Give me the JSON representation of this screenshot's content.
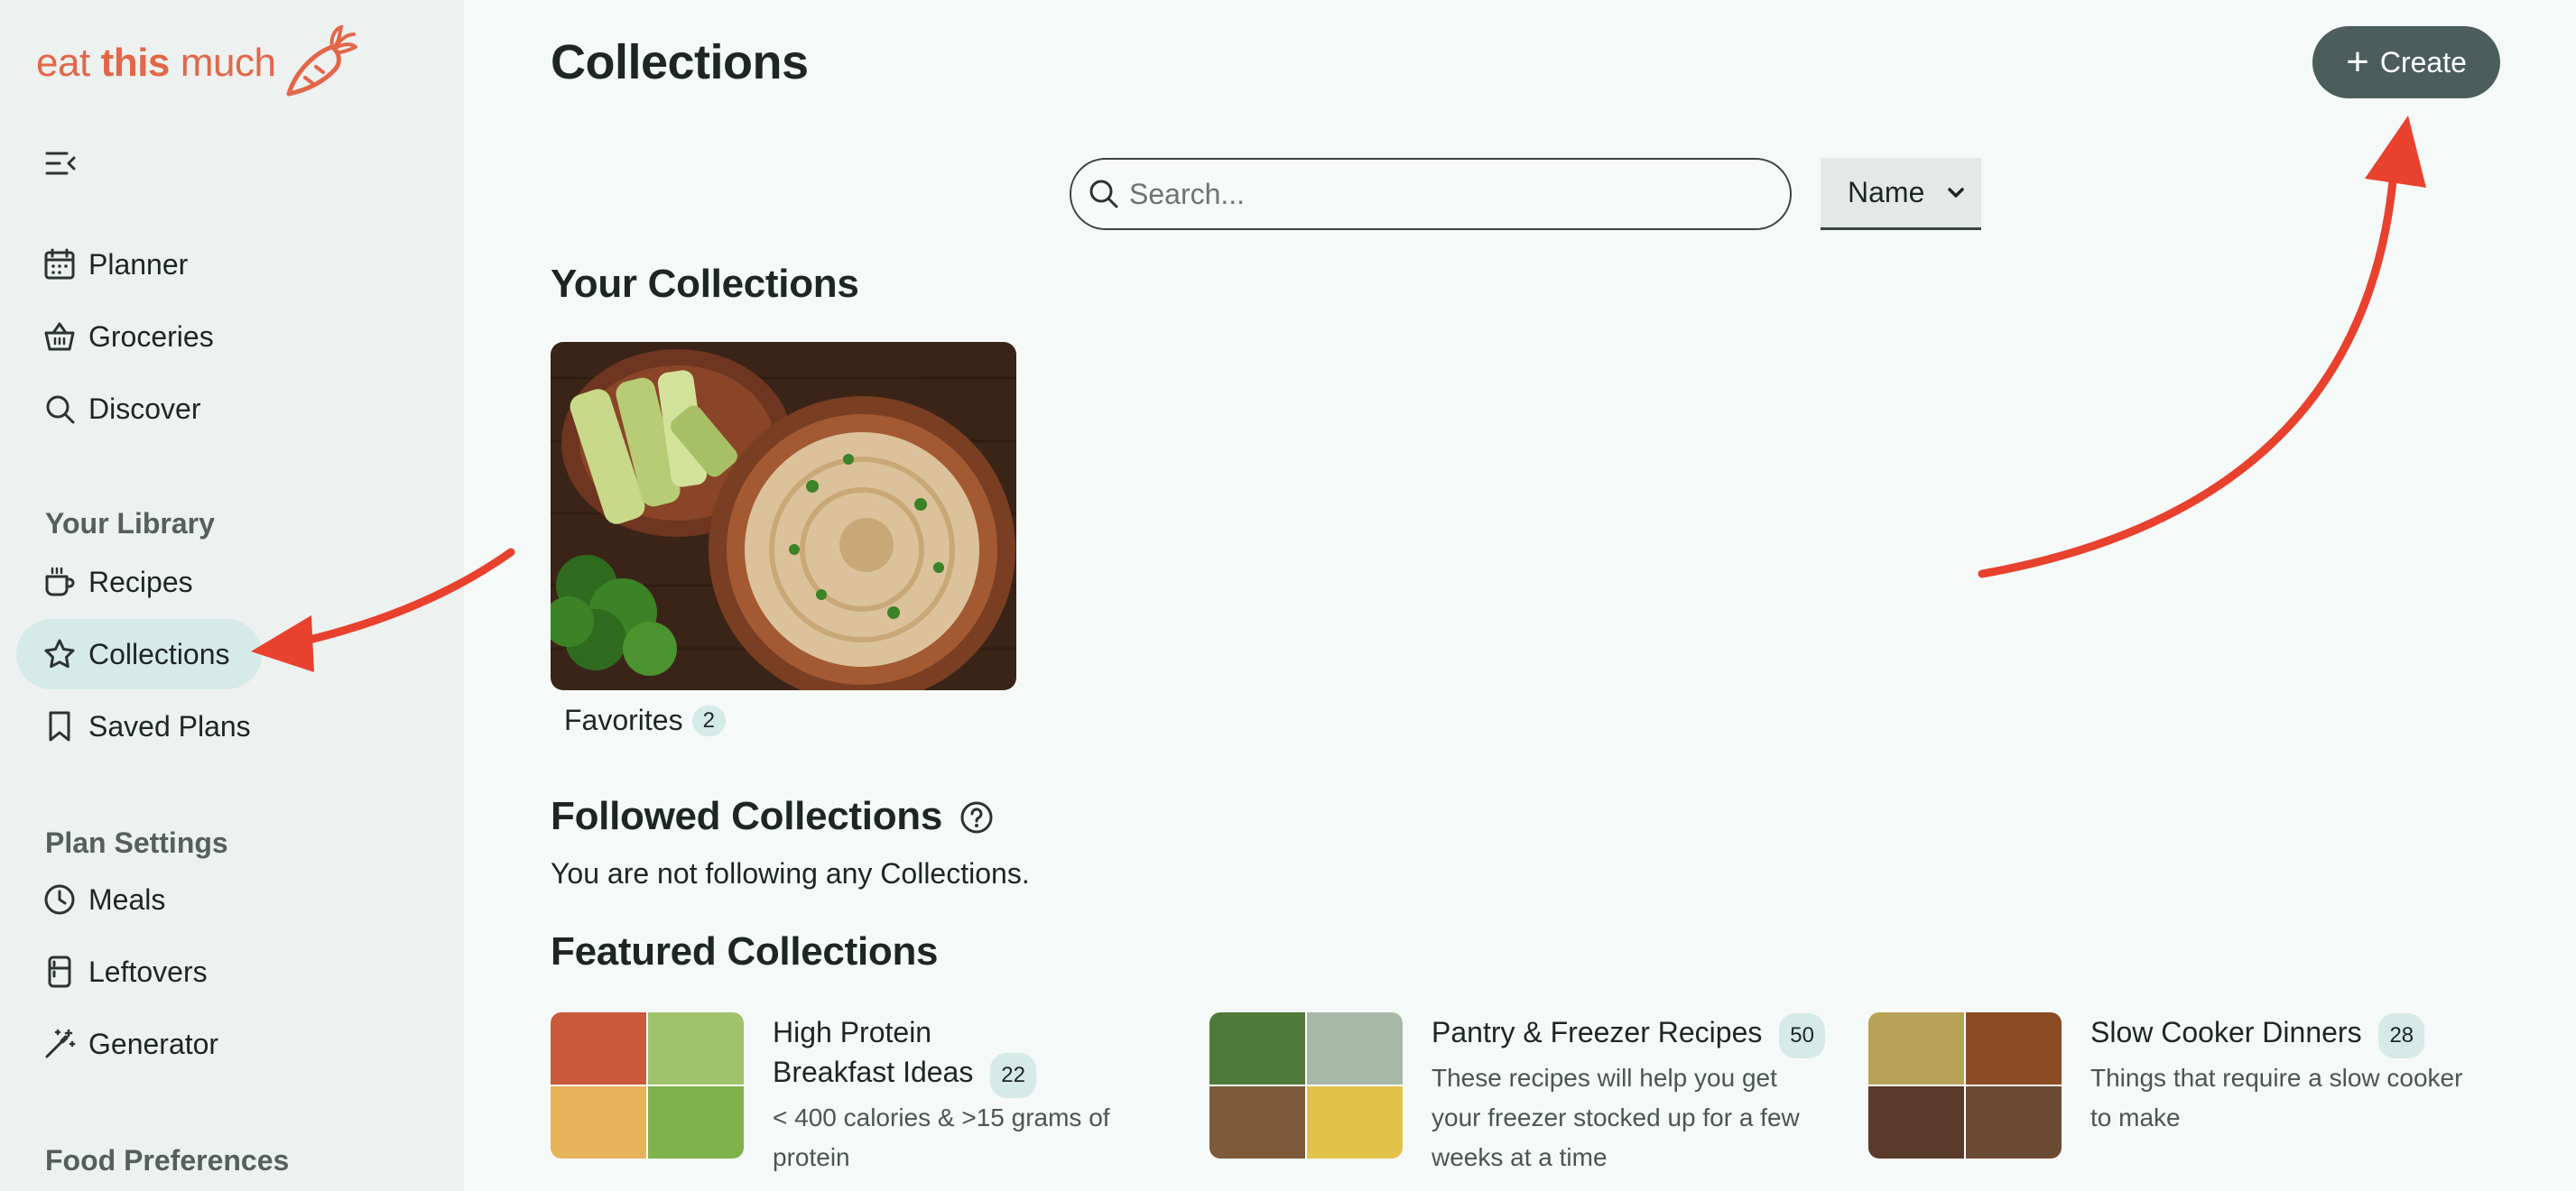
{
  "logo": {
    "word1": "eat",
    "word2": "this",
    "word3": "much"
  },
  "sidebar": {
    "nav": [
      {
        "label": "Planner"
      },
      {
        "label": "Groceries"
      },
      {
        "label": "Discover"
      }
    ],
    "library_title": "Your Library",
    "library": [
      {
        "label": "Recipes"
      },
      {
        "label": "Collections",
        "active": true
      },
      {
        "label": "Saved Plans"
      }
    ],
    "plan_settings_title": "Plan Settings",
    "plan_settings": [
      {
        "label": "Meals"
      },
      {
        "label": "Leftovers"
      },
      {
        "label": "Generator"
      }
    ],
    "food_prefs_title": "Food Preferences"
  },
  "header": {
    "title": "Collections",
    "create_label": "Create"
  },
  "search": {
    "placeholder": "Search...",
    "sort_value": "Name"
  },
  "your_collections": {
    "title": "Your Collections",
    "items": [
      {
        "name": "Favorites",
        "count": "2"
      }
    ]
  },
  "followed": {
    "title": "Followed Collections",
    "empty": "You are not following any Collections."
  },
  "featured": {
    "title": "Featured Collections",
    "items": [
      {
        "title_line1": "High Protein",
        "title_line2": "Breakfast Ideas",
        "count": "22",
        "desc_line1": "< 400 calories & >15 grams of",
        "desc_line2": "protein"
      },
      {
        "title": "Pantry & Freezer Recipes",
        "count": "50",
        "desc_line1": "These recipes will help you get",
        "desc_line2": "your freezer stocked up for a few",
        "desc_line3": "weeks at a time"
      },
      {
        "title": "Slow Cooker Dinners",
        "count": "28",
        "desc_line1": "Things that require a slow cooker",
        "desc_line2": "to make"
      }
    ]
  },
  "colors": {
    "brand": "#e2674a",
    "active_bg": "#d6eae8",
    "button": "#4c5e5c",
    "arrow": "#e8412e"
  }
}
